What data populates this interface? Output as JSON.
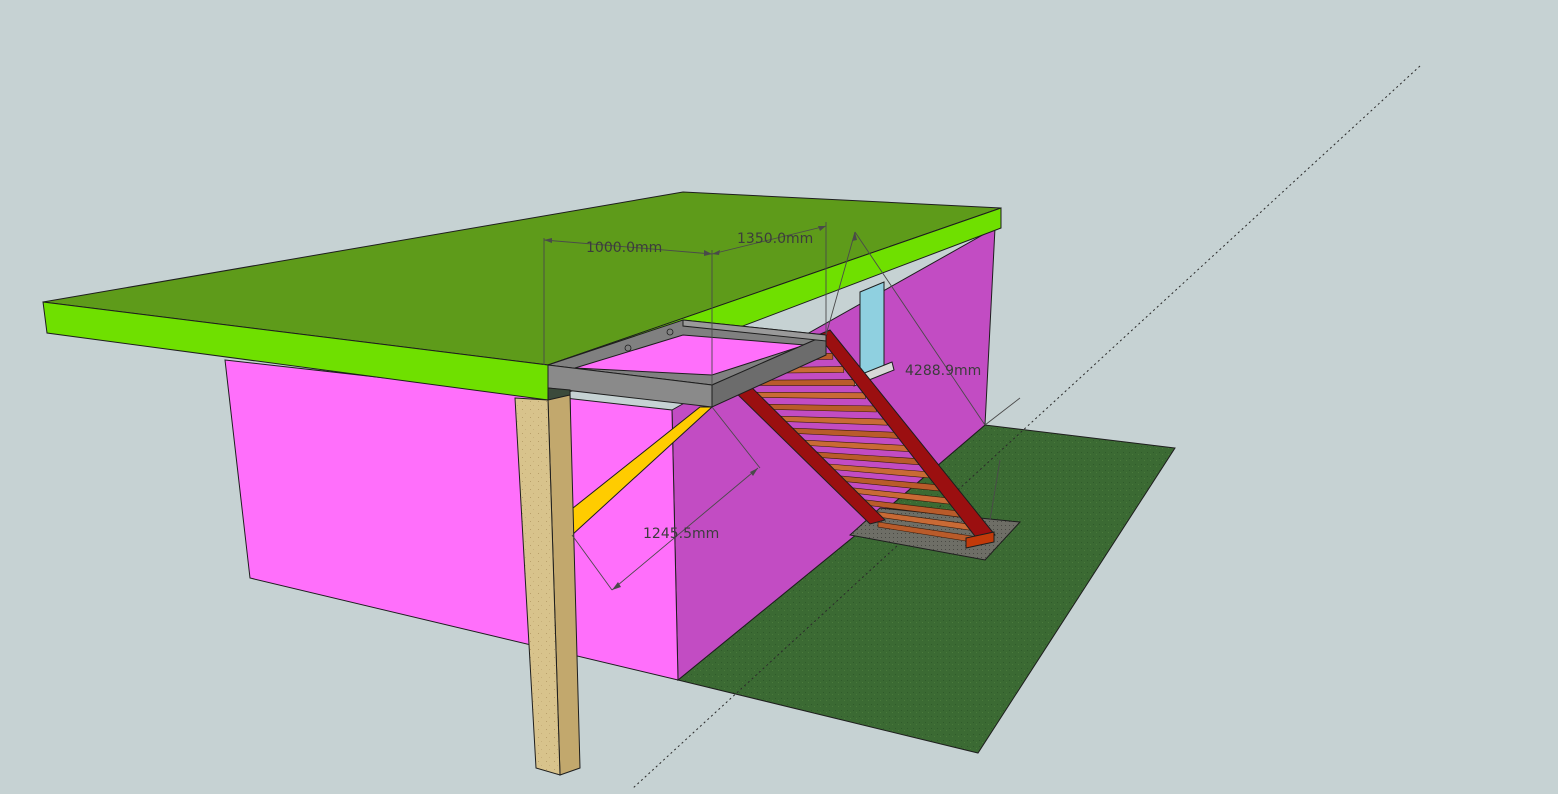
{
  "scene": {
    "background": "#c6d2d3",
    "colors": {
      "roof_top": "#5e9b1a",
      "roof_edge": "#6fe000",
      "wall_front": "#ff6ffb",
      "wall_side": "#c24cc3",
      "ground": "#3b6a33",
      "post": "#d8c38c",
      "beam_frame": "#808080",
      "brace": "#ffcc00",
      "stringer": "#9b0f10",
      "tread": "#b95b2a",
      "window": "#8fd0e0"
    }
  },
  "dimensions": {
    "d1": "1000.0mm",
    "d2": "1350.0mm",
    "d3": "4288.9mm",
    "d4": "1245.5mm"
  }
}
